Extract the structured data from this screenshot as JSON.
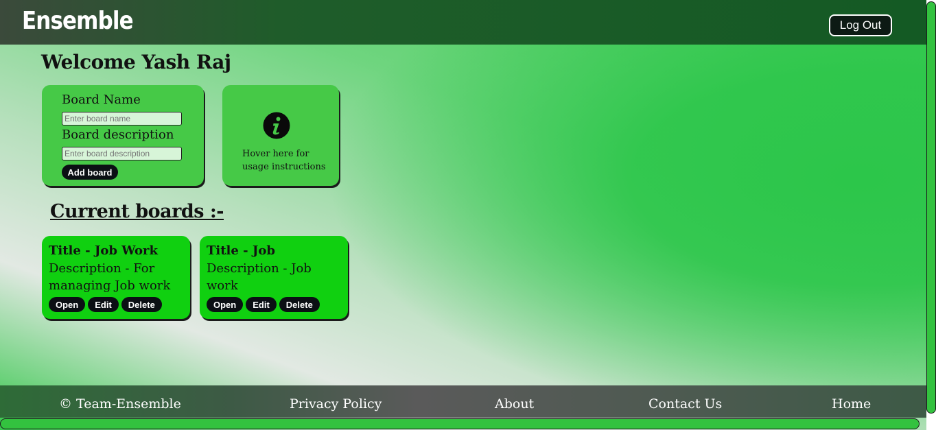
{
  "header": {
    "logo": "Ensemble",
    "logout_label": "Log Out"
  },
  "welcome": "Welcome Yash Raj",
  "add_board_form": {
    "name_label": "Board Name",
    "name_placeholder": "Enter board name",
    "description_label": "Board description",
    "description_placeholder": "Enter board description",
    "submit_label": "Add board"
  },
  "info_panel": {
    "icon": "info-icon",
    "text": "Hover here for usage instructions"
  },
  "boards_heading": "Current boards :-",
  "boards": [
    {
      "title": "Title - Job Work",
      "description": "Description - For managing Job work",
      "open_label": "Open",
      "edit_label": "Edit",
      "delete_label": "Delete"
    },
    {
      "title": "Title - Job",
      "description": "Description - Job work",
      "open_label": "Open",
      "edit_label": "Edit",
      "delete_label": "Delete"
    }
  ],
  "footer": {
    "copyright": "© Team-Ensemble",
    "privacy": "Privacy Policy",
    "about": "About",
    "contact": "Contact Us",
    "home": "Home"
  },
  "colors": {
    "accent_green": "#10d010",
    "card_green": "#46c947",
    "header_dark": "#145a24",
    "button_dark": "#0b0f14"
  }
}
